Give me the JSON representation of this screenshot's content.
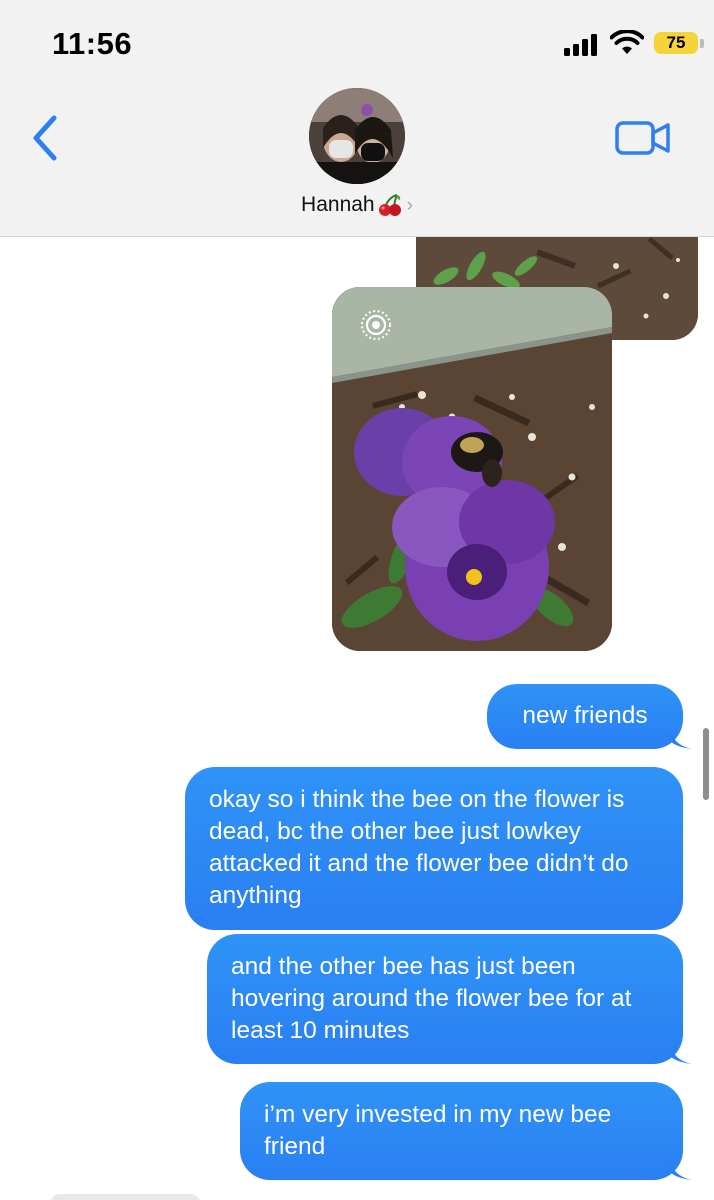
{
  "status_bar": {
    "time": "11:56",
    "battery": "75",
    "battery_color": "#f7d33a"
  },
  "header": {
    "contact_name": "Hannah",
    "back_icon": "chevron-left-icon",
    "video_icon": "video-camera-icon",
    "accent_color": "#2f7ff0"
  },
  "messages": [
    {
      "type": "photo",
      "description_icon": "live-photo-icon"
    },
    {
      "type": "text",
      "text": "new friends"
    },
    {
      "type": "text",
      "text": "okay so i think the bee on the flower is dead, bc the other bee just lowkey attacked it and the flower bee didn’t do anything"
    },
    {
      "type": "text",
      "text": "and the other bee has just been hovering around the flower bee for at least 10 minutes"
    },
    {
      "type": "text",
      "text": "i’m very invested in my new bee friend"
    }
  ],
  "bubble_color": "#2f8bf5"
}
